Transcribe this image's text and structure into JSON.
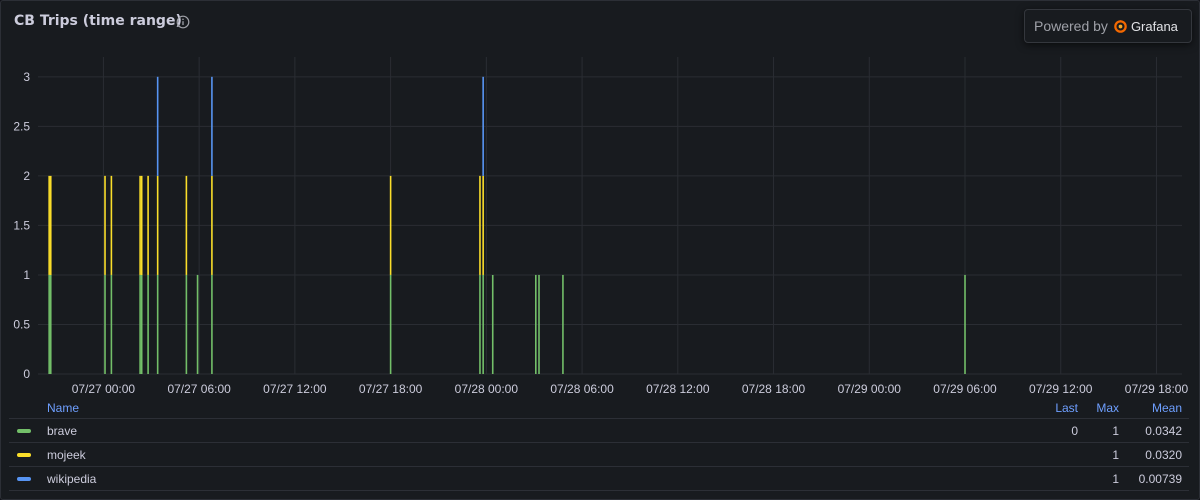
{
  "panel": {
    "title": "CB Trips (time range)",
    "powered_by": "Powered by",
    "brand": "Grafana"
  },
  "legend": {
    "headers": {
      "name": "Name",
      "last": "Last",
      "max": "Max",
      "mean": "Mean"
    },
    "rows": [
      {
        "name": "brave",
        "last": "0",
        "max": "1",
        "mean": "0.0342",
        "color": "#73bf69"
      },
      {
        "name": "mojeek",
        "last": "",
        "max": "1",
        "mean": "0.0320",
        "color": "#fade2a"
      },
      {
        "name": "wikipedia",
        "last": "",
        "max": "1",
        "mean": "0.00739",
        "color": "#5794f2"
      }
    ]
  },
  "chart_data": {
    "type": "bar",
    "stacked": true,
    "x_unit": "hours",
    "xlim": [
      -4.1,
      67.6
    ],
    "ylim": [
      0,
      3.2
    ],
    "grid": true,
    "legend_placement": "bottom",
    "x_ticks": [
      {
        "x": 0,
        "label": "07/27 00:00"
      },
      {
        "x": 6,
        "label": "07/27 06:00"
      },
      {
        "x": 12,
        "label": "07/27 12:00"
      },
      {
        "x": 18,
        "label": "07/27 18:00"
      },
      {
        "x": 24,
        "label": "07/28 00:00"
      },
      {
        "x": 30,
        "label": "07/28 06:00"
      },
      {
        "x": 36,
        "label": "07/28 12:00"
      },
      {
        "x": 42,
        "label": "07/28 18:00"
      },
      {
        "x": 48,
        "label": "07/29 00:00"
      },
      {
        "x": 54,
        "label": "07/29 06:00"
      },
      {
        "x": 60,
        "label": "07/29 12:00"
      },
      {
        "x": 66,
        "label": "07/29 18:00"
      }
    ],
    "y_ticks": [
      {
        "y": 0,
        "label": "0"
      },
      {
        "y": 0.5,
        "label": "0.5"
      },
      {
        "y": 1,
        "label": "1"
      },
      {
        "y": 1.5,
        "label": "1.5"
      },
      {
        "y": 2,
        "label": "2"
      },
      {
        "y": 2.5,
        "label": "2.5"
      },
      {
        "y": 3,
        "label": "3"
      }
    ],
    "series": [
      {
        "name": "brave",
        "color": "#73bf69",
        "points": [
          [
            -3.4,
            1
          ],
          [
            -3.3,
            1
          ],
          [
            0.1,
            1
          ],
          [
            0.5,
            1
          ],
          [
            2.3,
            1
          ],
          [
            2.4,
            1
          ],
          [
            2.8,
            1
          ],
          [
            3.4,
            1
          ],
          [
            5.2,
            1
          ],
          [
            5.9,
            1
          ],
          [
            6.8,
            1
          ],
          [
            18.0,
            1
          ],
          [
            23.6,
            1
          ],
          [
            23.8,
            1
          ],
          [
            24.4,
            1
          ],
          [
            27.1,
            1
          ],
          [
            27.3,
            1
          ],
          [
            28.8,
            1
          ],
          [
            54.0,
            1
          ]
        ]
      },
      {
        "name": "mojeek",
        "color": "#fade2a",
        "points": [
          [
            -3.4,
            1
          ],
          [
            -3.3,
            1
          ],
          [
            0.1,
            1
          ],
          [
            0.5,
            1
          ],
          [
            2.3,
            1
          ],
          [
            2.4,
            1
          ],
          [
            2.8,
            1
          ],
          [
            3.4,
            1
          ],
          [
            5.2,
            1
          ],
          [
            6.8,
            1
          ],
          [
            18.0,
            1
          ],
          [
            23.6,
            1
          ],
          [
            23.8,
            1
          ]
        ]
      },
      {
        "name": "wikipedia",
        "color": "#5794f2",
        "points": [
          [
            3.4,
            1
          ],
          [
            6.8,
            1
          ],
          [
            23.8,
            1
          ]
        ]
      }
    ]
  }
}
